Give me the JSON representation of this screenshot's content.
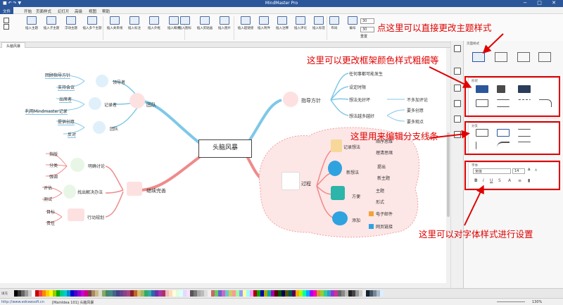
{
  "app": {
    "title": "MindMaster Pro",
    "quick_access": "■ ↶ ↷ ▼",
    "window_controls": "− □ ✕"
  },
  "menu": [
    "文件",
    "开始",
    "页面样式",
    "幻灯片",
    "高级",
    "视图",
    "帮助"
  ],
  "ribbon": {
    "buttons": [
      "插入主题",
      "插入子主题",
      "浮动主题",
      "插入多个主题",
      "插入关系线",
      "插入标注",
      "插入外框",
      "插入概要",
      "插入图标",
      "插入剪贴画",
      "插入图片",
      "插入超链接",
      "插入附件",
      "插入注释",
      "插入评论",
      "插入标签",
      "布局",
      "编号"
    ],
    "spin_value": "30",
    "reset_label": "重置"
  },
  "doc_tab": "头脑风暴",
  "panel": {
    "tab_title": "页面样式",
    "section_frame": "形状",
    "section_branch": "分支",
    "section_font": "字体",
    "font_name": "宋体",
    "font_size": "14"
  },
  "annotations": {
    "theme": "点这里可以直接更改主题样式",
    "frame": "这里可以更改框架颜色样式粗细等",
    "branch": "这里用来编辑分支线条",
    "font": "这里可以对字体样式进行设置"
  },
  "mindmap": {
    "root": "头脑风暴",
    "team": {
      "label": "团队",
      "guide": "领导者",
      "guide_items": [
        "回顾指导方针",
        "支持会议"
      ],
      "recorder": "记录者",
      "recorder_items": [
        "出席者",
        "利用Mindmaster记录"
      ],
      "team_sub": "团队",
      "team_items": [
        "提供创意",
        "反对"
      ]
    },
    "improve": {
      "label": "继续完善",
      "discuss": "明确讨论",
      "discuss_items": [
        "指版",
        "分类",
        "强调"
      ],
      "solve": "找出解决办法",
      "solve_items": [
        "评估",
        "测试"
      ],
      "plan": "行动规划",
      "plan_items": [
        "目标",
        "责任"
      ]
    },
    "guide_branch": {
      "label": "指导方针",
      "items": [
        "任何事都可能发生",
        "设定时限",
        "想法无好坏",
        "想法越多越好"
      ],
      "sub1": "不多加评论",
      "sub2": [
        "要多创意",
        "要多观点"
      ]
    },
    "process": {
      "label": "过程",
      "record": "记录想法",
      "record_items": [
        "顺序思维",
        "理清思绪"
      ],
      "new": "新想法",
      "new_items": [
        "提出",
        "新主题"
      ],
      "convenient": "方便",
      "convenient_items": [
        "主题",
        "形式"
      ],
      "add": "添加",
      "add_items": [
        "电子邮件",
        "网页链接"
      ]
    }
  },
  "status": {
    "url": "http://www.edrawsoft.cn",
    "doc": "[MainIdea 101]  头脑风暴",
    "zoom": "130%"
  },
  "palette_label": "填充"
}
